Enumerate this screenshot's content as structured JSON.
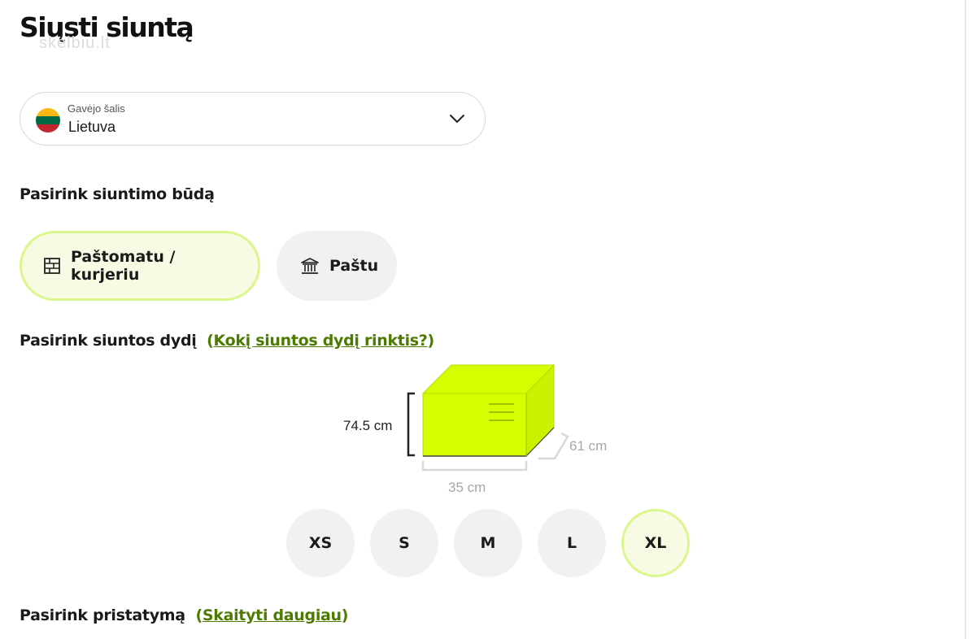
{
  "page": {
    "title": "Siųsti siuntą",
    "watermark": "skelbiu.lt"
  },
  "country": {
    "label": "Gavėjo šalis",
    "value": "Lietuva",
    "flag_icon": "lithuania-flag-icon",
    "dropdown_icon": "chevron-down-icon"
  },
  "shipping_method": {
    "heading": "Pasirink siuntimo būdą",
    "options": [
      {
        "label": "Paštomatu / kurjeriu",
        "icon": "parcel-locker-icon",
        "selected": true
      },
      {
        "label": "Paštu",
        "icon": "post-office-icon",
        "selected": false
      }
    ]
  },
  "parcel_size": {
    "heading": "Pasirink siuntos dydį",
    "link_text": "Kokį siuntos dydį rinktis?",
    "open_paren": "(",
    "close_paren": ")",
    "dimensions": {
      "height": "74.5 cm",
      "width": "35 cm",
      "depth": "61 cm"
    },
    "sizes": [
      {
        "label": "XS",
        "selected": false
      },
      {
        "label": "S",
        "selected": false
      },
      {
        "label": "M",
        "selected": false
      },
      {
        "label": "L",
        "selected": false
      },
      {
        "label": "XL",
        "selected": true
      }
    ]
  },
  "delivery": {
    "heading": "Pasirink pristatymą",
    "link_text": "Skaityti daugiau",
    "open_paren": "(",
    "close_paren": ")"
  },
  "colors": {
    "accent_lime": "#d4ff00",
    "selected_border": "#d9f78a",
    "selected_bg": "#f8fbe4",
    "link_green": "#4d7a00",
    "inactive_bg": "#f1f1f1"
  }
}
